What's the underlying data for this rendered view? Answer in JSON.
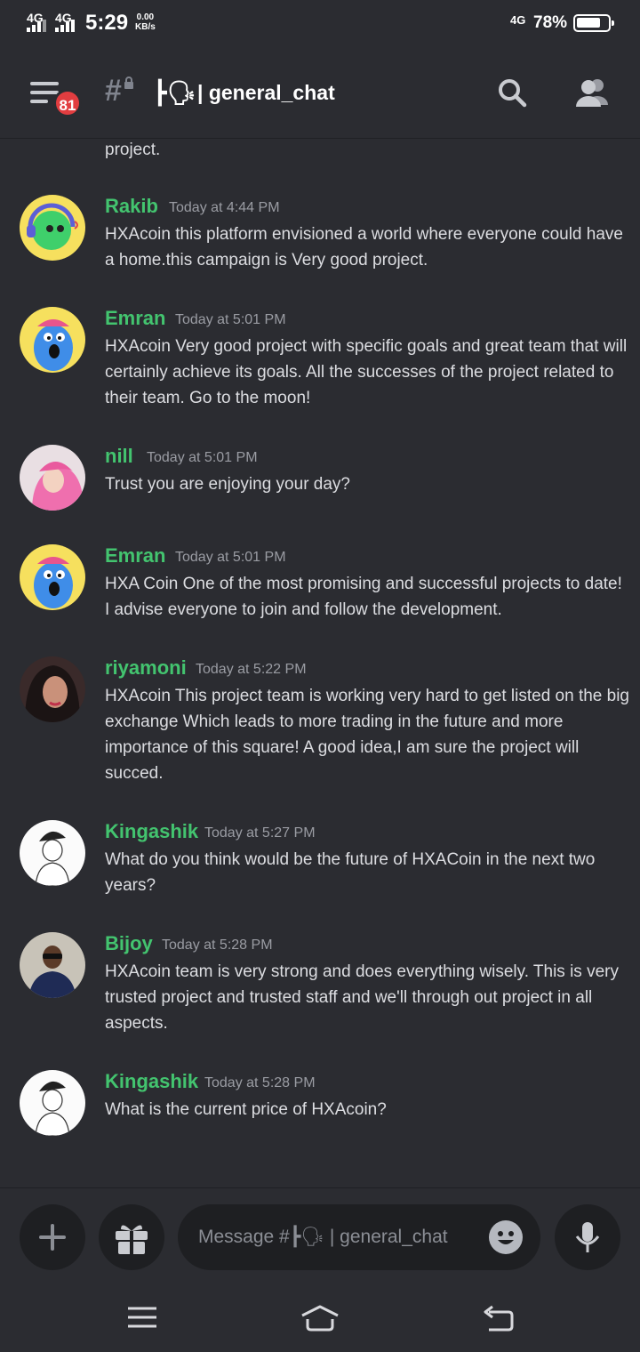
{
  "status_bar": {
    "sim1": "4G",
    "sim2": "4G",
    "time": "5:29",
    "speed_value": "0.00",
    "speed_unit": "KB/s",
    "network": "4G",
    "battery": "78%",
    "battery_level": 0.78
  },
  "header": {
    "unread_badge": "81",
    "channel_emoji": "┣🗣",
    "channel_separator": "|",
    "channel_name": "general_chat"
  },
  "partial_message": "project.",
  "messages": [
    {
      "author": "Rakib",
      "time": "Today at 4:44 PM",
      "text": "HXAcoin this platform envisioned a world where everyone could have a home.this campaign is Very good project."
    },
    {
      "author": "Emran",
      "time": "Today at 5:01 PM",
      "text": "HXAcoin Very good project with specific goals and great team that will certainly achieve its goals. All the successes of the project related to their team. Go to the moon!"
    },
    {
      "author": "nill",
      "time": "Today at 5:01 PM",
      "text": "Trust you are enjoying your day?"
    },
    {
      "author": "Emran",
      "time": "Today at 5:01 PM",
      "text": "HXA Coin One of the most promising and successful projects to date! I advise everyone to join and follow the development."
    },
    {
      "author": "riyamoni",
      "time": "Today at 5:22 PM",
      "text": "HXAcoin This project team is working very hard to get listed on the big exchange Which leads to more trading in the future and more importance of this square! A good idea,I am sure the project will succed."
    },
    {
      "author": "Kingashik",
      "time": "Today at 5:27 PM",
      "text": "What do you think would be the future of HXACoin in the next two years?"
    },
    {
      "author": "Bijoy",
      "time": "Today at 5:28 PM",
      "text": "HXAcoin team is very strong and does everything wisely. This is very trusted project and trusted staff and we'll through out project in all aspects."
    },
    {
      "author": "Kingashik",
      "time": "Today at 5:28 PM",
      "text": "What is the current price of HXAcoin?"
    }
  ],
  "composer": {
    "placeholder": "Message #┣🗣 | general_chat"
  },
  "colors": {
    "background": "#2b2c31",
    "username": "#43c46f",
    "badge": "#e23d40",
    "input_bg": "#1e1f22"
  }
}
